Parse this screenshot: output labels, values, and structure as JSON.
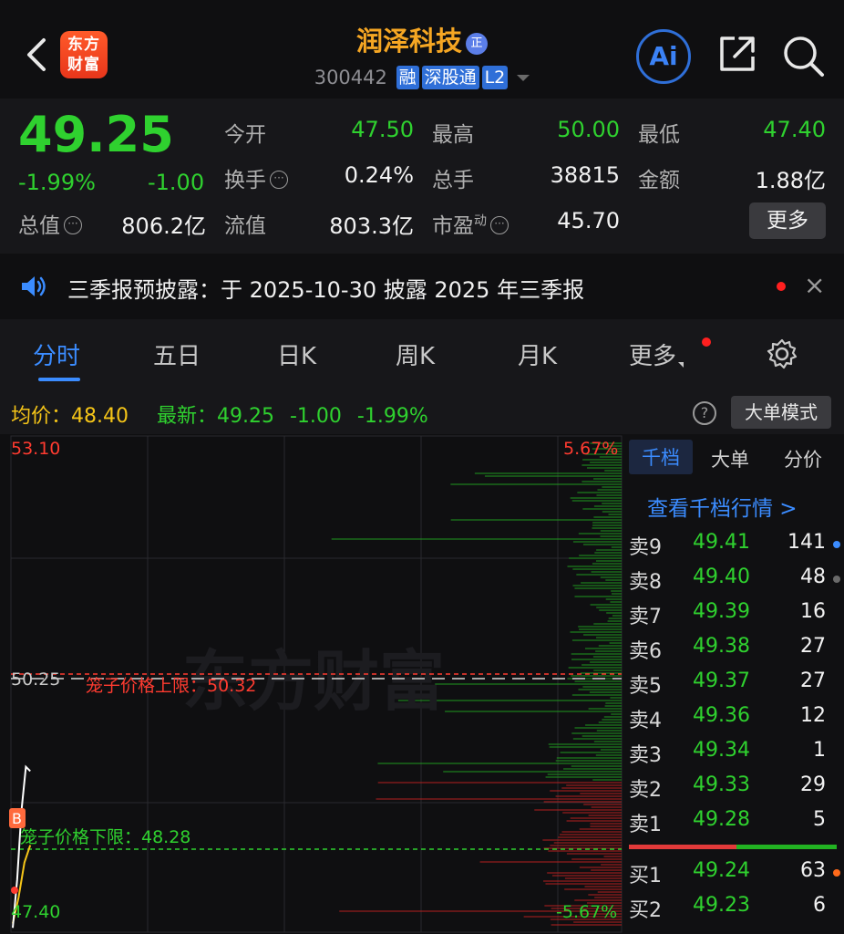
{
  "header": {
    "logo_text": "东方财富",
    "stock_name": "润泽科技",
    "name_badge": "正",
    "code": "300442",
    "tags": [
      "融",
      "深股通",
      "L2"
    ],
    "ai_label": "Ai"
  },
  "quote": {
    "price": "49.25",
    "change_pct": "-1.99%",
    "change": "-1.00",
    "fields": [
      {
        "label": "今开",
        "value": "47.50",
        "color": "green"
      },
      {
        "label": "最高",
        "value": "50.00",
        "color": "green"
      },
      {
        "label": "最低",
        "value": "47.40",
        "color": "green"
      },
      {
        "label": "换手",
        "value": "0.24%",
        "color": "white",
        "info": true
      },
      {
        "label": "总手",
        "value": "38815",
        "color": "white"
      },
      {
        "label": "金额",
        "value": "1.88亿",
        "color": "white"
      },
      {
        "label": "总值",
        "value": "806.2亿",
        "color": "white",
        "info": true
      },
      {
        "label": "流值",
        "value": "803.3亿",
        "color": "white"
      },
      {
        "label": "市盈",
        "sup": "动",
        "value": "45.70",
        "color": "white",
        "info": true
      }
    ],
    "more_label": "更多"
  },
  "notice": {
    "text": "三季报预披露：于 2025-10-30 披露 2025 年三季报",
    "close": "×"
  },
  "tabs": [
    "分时",
    "五日",
    "日K",
    "周K",
    "月K",
    "更多"
  ],
  "active_tab": "分时",
  "chart_header": {
    "avg": "均价：48.40",
    "latest": "最新：49.25",
    "latest_change": "-1.00",
    "latest_pct": "-1.99%",
    "help": "?",
    "mode_button": "大单模式"
  },
  "chart": {
    "price_top": "53.10",
    "pct_top": "5.67%",
    "price_mid": "50.25",
    "price_bottom": "47.40",
    "pct_bottom": "-5.67%",
    "upper_cage_label": "笼子价格上限：50.32",
    "lower_cage_label": "笼子价格下限：48.28",
    "watermark": "东方财富",
    "trade_marker": "B"
  },
  "chart_data": {
    "type": "line",
    "ylim": [
      47.4,
      53.1
    ],
    "y_ref": 50.25,
    "cage_upper": 50.32,
    "cage_lower": 48.28,
    "price_series": [
      [
        0,
        47.45
      ],
      [
        0.3,
        48.0
      ],
      [
        0.6,
        48.8
      ],
      [
        0.9,
        49.3
      ],
      [
        1.2,
        49.25
      ]
    ],
    "avg_series": [
      [
        0,
        47.5
      ],
      [
        0.4,
        47.8
      ],
      [
        0.8,
        48.2
      ],
      [
        1.2,
        48.4
      ]
    ]
  },
  "order_book": {
    "tabs": [
      "千档",
      "大单",
      "分价"
    ],
    "active_tab": "千档",
    "depth_link": "查看千档行情 >",
    "asks": [
      {
        "label": "卖9",
        "price": "49.41",
        "vol": "141",
        "dot": "#3b8cff"
      },
      {
        "label": "卖8",
        "price": "49.40",
        "vol": "48",
        "dot": "#6a6a6a"
      },
      {
        "label": "卖7",
        "price": "49.39",
        "vol": "16",
        "dot": ""
      },
      {
        "label": "卖6",
        "price": "49.38",
        "vol": "27",
        "dot": ""
      },
      {
        "label": "卖5",
        "price": "49.37",
        "vol": "27",
        "dot": ""
      },
      {
        "label": "卖4",
        "price": "49.36",
        "vol": "12",
        "dot": ""
      },
      {
        "label": "卖3",
        "price": "49.34",
        "vol": "1",
        "dot": ""
      },
      {
        "label": "卖2",
        "price": "49.33",
        "vol": "29",
        "dot": ""
      },
      {
        "label": "卖1",
        "price": "49.28",
        "vol": "5",
        "dot": ""
      }
    ],
    "bids": [
      {
        "label": "买1",
        "price": "49.24",
        "vol": "63",
        "dot": "#ff6a1a"
      },
      {
        "label": "买2",
        "price": "49.23",
        "vol": "6",
        "dot": ""
      }
    ]
  },
  "colors": {
    "up": "#ff3b30",
    "down": "#2fd12f",
    "accent": "#3b8cff",
    "name": "#f5a623"
  }
}
